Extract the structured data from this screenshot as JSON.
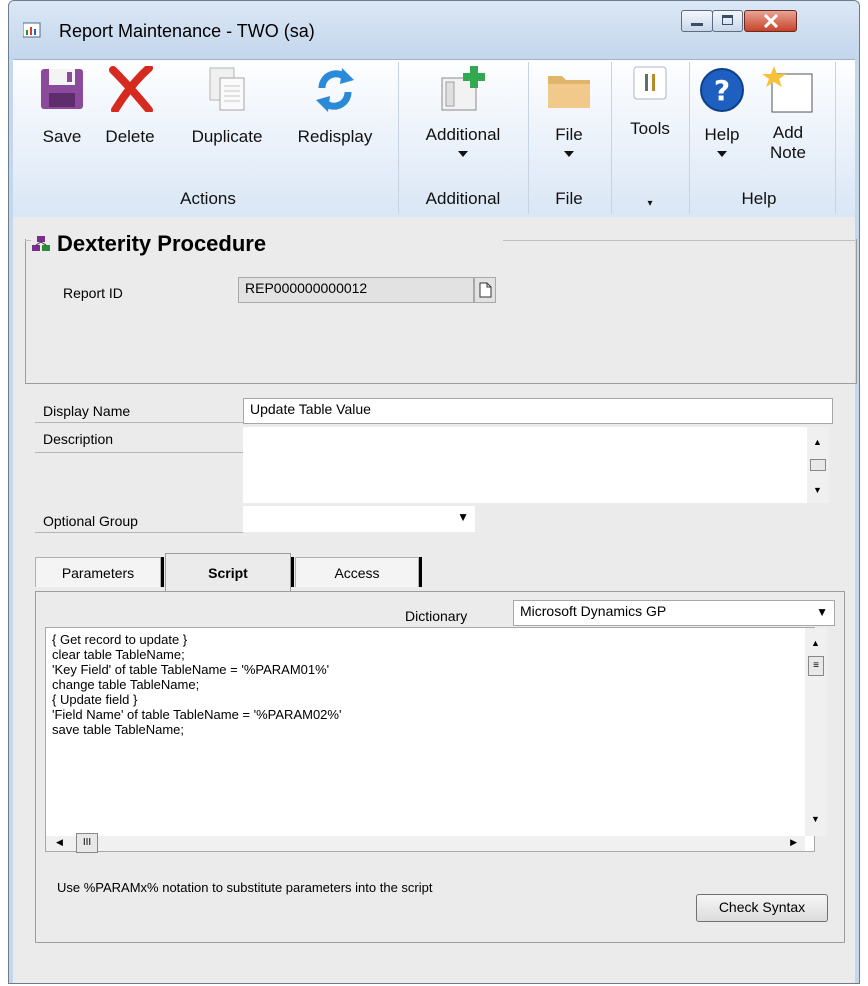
{
  "window": {
    "title": "Report Maintenance  -  TWO (sa)"
  },
  "ribbon": {
    "buttons": {
      "save": "Save",
      "delete": "Delete",
      "duplicate": "Duplicate",
      "redisplay": "Redisplay",
      "additional": "Additional",
      "file": "File",
      "tools": "Tools",
      "help": "Help",
      "add_note_1": "Add",
      "add_note_2": "Note"
    },
    "groups": {
      "actions": "Actions",
      "additional": "Additional",
      "file": "File",
      "help": "Help"
    }
  },
  "section": {
    "title": "Dexterity Procedure"
  },
  "form": {
    "report_id_label": "Report ID",
    "report_id_value": "REP000000000012",
    "display_name_label": "Display Name",
    "display_name_value": "Update Table Value",
    "description_label": "Description",
    "optional_group_label": "Optional Group",
    "optional_group_value": ""
  },
  "tabs": [
    {
      "label": "Parameters"
    },
    {
      "label": "Script",
      "active": true
    },
    {
      "label": "Access"
    }
  ],
  "script_tab": {
    "dictionary_label": "Dictionary",
    "dictionary_value": "Microsoft Dynamics GP",
    "lines": [
      "{ Get record to update }",
      "clear table TableName;",
      "'Key Field' of table TableName = '%PARAM01%'",
      "change table TableName;",
      "",
      "{ Update field }",
      "'Field Name' of table TableName = '%PARAM02%'",
      "save table TableName;"
    ],
    "hint": "Use %PARAMx% notation to substitute parameters into the script",
    "check_syntax": "Check Syntax"
  },
  "colors": {
    "save_icon": "#8b4a9c",
    "delete_icon": "#d62a1e",
    "redisplay_icon": "#2b8ad8",
    "help_icon": "#1f5fbf"
  }
}
